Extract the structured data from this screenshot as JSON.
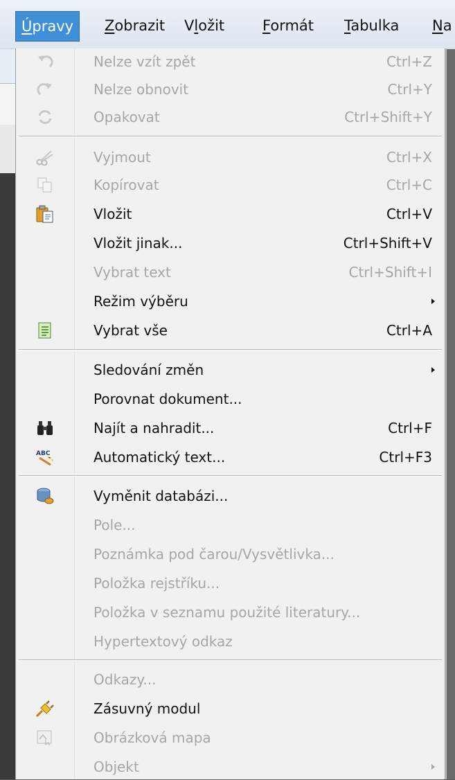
{
  "menubar": {
    "items": [
      {
        "label": "Úpravy",
        "active": true
      },
      {
        "label": "Zobrazit",
        "active": false
      },
      {
        "label": "Vložit",
        "active": false
      },
      {
        "label": "Formát",
        "active": false
      },
      {
        "label": "Tabulka",
        "active": false
      },
      {
        "label": "Na",
        "active": false
      }
    ]
  },
  "menu": {
    "items": [
      {
        "label": "Nelze vzít zpět",
        "shortcut": "Ctrl+Z",
        "enabled": false,
        "icon": "undo-icon"
      },
      {
        "label": "Nelze obnovit",
        "shortcut": "Ctrl+Y",
        "enabled": false,
        "icon": "redo-icon"
      },
      {
        "label": "Opakovat",
        "shortcut": "Ctrl+Shift+Y",
        "enabled": false,
        "icon": "repeat-icon"
      },
      {
        "label": "Vyjmout",
        "shortcut": "Ctrl+X",
        "enabled": false,
        "icon": "scissors-icon"
      },
      {
        "label": "Kopírovat",
        "shortcut": "Ctrl+C",
        "enabled": false,
        "icon": "copy-icon"
      },
      {
        "label": "Vložit",
        "shortcut": "Ctrl+V",
        "enabled": true,
        "icon": "paste-icon"
      },
      {
        "label": "Vložit jinak...",
        "shortcut": "Ctrl+Shift+V",
        "enabled": true,
        "icon": ""
      },
      {
        "label": "Vybrat text",
        "shortcut": "Ctrl+Shift+I",
        "enabled": false,
        "icon": ""
      },
      {
        "label": "Režim výběru",
        "shortcut": "",
        "enabled": true,
        "icon": "",
        "submenu": true
      },
      {
        "label": "Vybrat vše",
        "shortcut": "Ctrl+A",
        "enabled": true,
        "icon": "select-all-icon"
      },
      {
        "label": "Sledování změn",
        "shortcut": "",
        "enabled": true,
        "icon": "",
        "submenu": true
      },
      {
        "label": "Porovnat dokument...",
        "shortcut": "",
        "enabled": true,
        "icon": ""
      },
      {
        "label": "Najít a nahradit...",
        "shortcut": "Ctrl+F",
        "enabled": true,
        "icon": "binoculars-icon"
      },
      {
        "label": "Automatický text...",
        "shortcut": "Ctrl+F3",
        "enabled": true,
        "icon": "autotext-icon"
      },
      {
        "label": "Vyměnit databázi...",
        "shortcut": "",
        "enabled": true,
        "icon": "database-icon"
      },
      {
        "label": "Pole...",
        "shortcut": "",
        "enabled": false,
        "icon": ""
      },
      {
        "label": "Poznámka pod čarou/Vysvětlivka...",
        "shortcut": "",
        "enabled": false,
        "icon": ""
      },
      {
        "label": "Položka rejstříku...",
        "shortcut": "",
        "enabled": false,
        "icon": ""
      },
      {
        "label": "Položka v seznamu použité literatury...",
        "shortcut": "",
        "enabled": false,
        "icon": ""
      },
      {
        "label": "Hypertextový odkaz",
        "shortcut": "",
        "enabled": false,
        "icon": ""
      },
      {
        "label": "Odkazy...",
        "shortcut": "",
        "enabled": false,
        "icon": ""
      },
      {
        "label": "Zásuvný modul",
        "shortcut": "",
        "enabled": true,
        "icon": "plugin-icon"
      },
      {
        "label": "Obrázková mapa",
        "shortcut": "",
        "enabled": false,
        "icon": "imagemap-icon"
      },
      {
        "label": "Objekt",
        "shortcut": "",
        "enabled": false,
        "icon": "",
        "submenu": true
      }
    ]
  },
  "colors": {
    "active_menu": "#3f8fd6",
    "menu_bg": "#f1f1f1",
    "disabled_text": "#a6a6a6"
  }
}
